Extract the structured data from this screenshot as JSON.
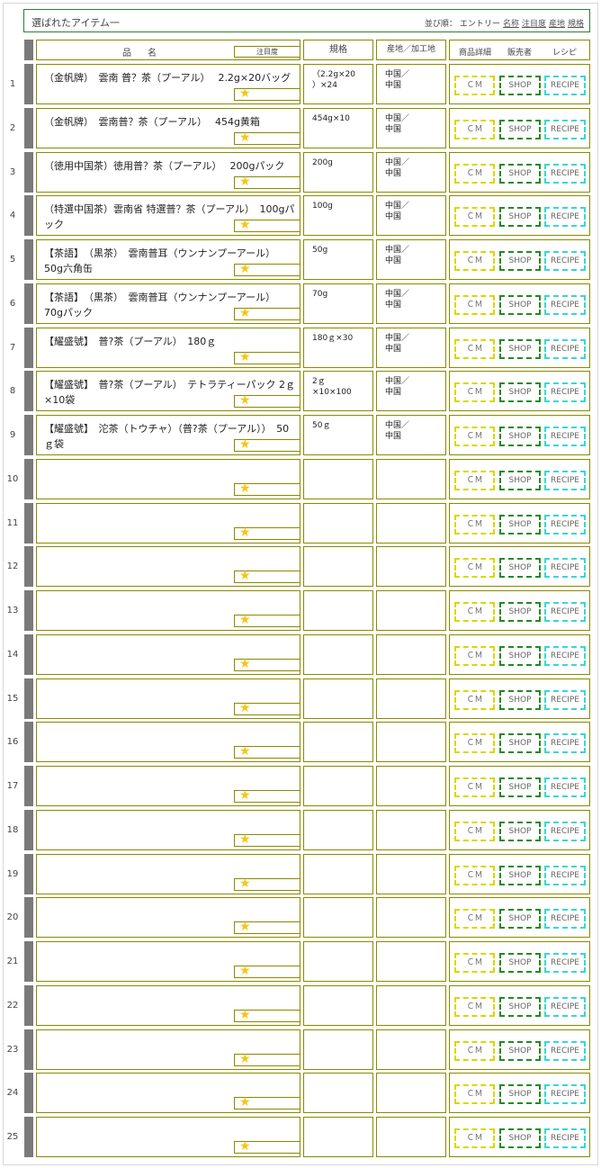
{
  "header": {
    "title": "選ばれたアイテム一",
    "sort_label": "並び順：",
    "sort_options": [
      "エントリー",
      "名称",
      "注目度",
      "産地",
      "規格"
    ]
  },
  "columns": {
    "name": "品　名",
    "attention": "注目度",
    "spec": "規格",
    "origin": "産地／加工地",
    "detail": "商品詳細",
    "seller": "販売者",
    "recipe": "レシピ"
  },
  "buttons": {
    "cm": "ＣＭ",
    "shop": "SHOP",
    "recipe": "RECIPE"
  },
  "star_icon": "★",
  "rows": [
    {
      "num": "1",
      "name": "（金帆牌）　雲南 普？茶（プーアル）　 2.2g×20バッグ",
      "spec": "（2.2g×20\n）×24",
      "origin": "中国／\n中国"
    },
    {
      "num": "2",
      "name": "（金帆牌）　雲南普？茶（プーアル）　 454g黄箱",
      "spec": "454g×10",
      "origin": "中国／\n中国"
    },
    {
      "num": "3",
      "name": "（徳用中国茶）徳用普？茶（プーアル）　 200gパック",
      "spec": "200g",
      "origin": "中国／\n中国"
    },
    {
      "num": "4",
      "name": "（特選中国茶）雲南省 特選普？茶（プーアル）　100gパック",
      "spec": "100g",
      "origin": "中国／\n中国"
    },
    {
      "num": "5",
      "name": "【茶語】　（黒茶）　雲南普耳（ウンナンプーアール）　50g六角缶",
      "spec": "50g",
      "origin": "中国／\n中国"
    },
    {
      "num": "6",
      "name": "【茶語】　（黒茶）　雲南普耳（ウンナンプーアール）　70gパック",
      "spec": "70g",
      "origin": "中国／\n中国"
    },
    {
      "num": "7",
      "name": "【耀盛號】　普?茶（プーアル）　180ｇ",
      "spec": "180ｇ×30",
      "origin": "中国／\n中国"
    },
    {
      "num": "8",
      "name": "【耀盛號】　普?茶（プーアル）　テトラティーパック 2ｇ×10袋",
      "spec": "2ｇ\n×10×100",
      "origin": "中国／\n中国"
    },
    {
      "num": "9",
      "name": "【耀盛號】　沱茶（トウチャ）（普?茶（プーアル））　50ｇ袋",
      "spec": "50ｇ",
      "origin": "中国／\n中国"
    },
    {
      "num": "10",
      "name": "",
      "spec": "",
      "origin": ""
    },
    {
      "num": "11",
      "name": "",
      "spec": "",
      "origin": ""
    },
    {
      "num": "12",
      "name": "",
      "spec": "",
      "origin": ""
    },
    {
      "num": "13",
      "name": "",
      "spec": "",
      "origin": ""
    },
    {
      "num": "14",
      "name": "",
      "spec": "",
      "origin": ""
    },
    {
      "num": "15",
      "name": "",
      "spec": "",
      "origin": ""
    },
    {
      "num": "16",
      "name": "",
      "spec": "",
      "origin": ""
    },
    {
      "num": "17",
      "name": "",
      "spec": "",
      "origin": ""
    },
    {
      "num": "18",
      "name": "",
      "spec": "",
      "origin": ""
    },
    {
      "num": "19",
      "name": "",
      "spec": "",
      "origin": ""
    },
    {
      "num": "20",
      "name": "",
      "spec": "",
      "origin": ""
    },
    {
      "num": "21",
      "name": "",
      "spec": "",
      "origin": ""
    },
    {
      "num": "22",
      "name": "",
      "spec": "",
      "origin": ""
    },
    {
      "num": "23",
      "name": "",
      "spec": "",
      "origin": ""
    },
    {
      "num": "24",
      "name": "",
      "spec": "",
      "origin": ""
    },
    {
      "num": "25",
      "name": "",
      "spec": "",
      "origin": ""
    }
  ]
}
